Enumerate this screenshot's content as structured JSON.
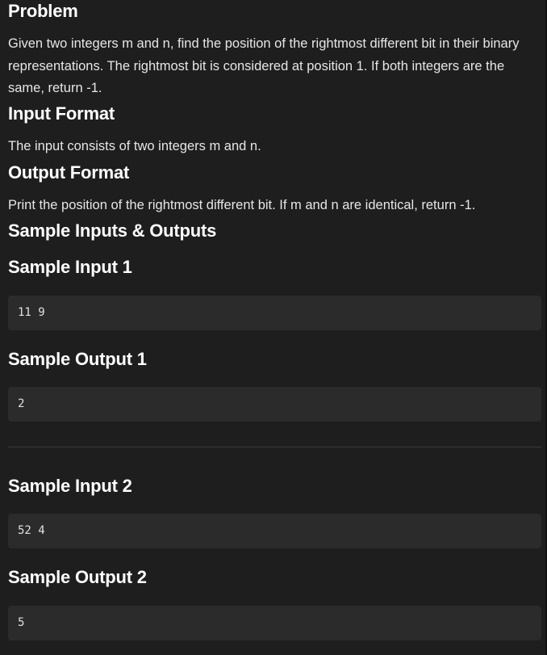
{
  "problem": {
    "heading": "Problem",
    "description": "Given two integers m and n, find the position of the rightmost different bit in their binary representations. The rightmost bit is considered at position 1. If both integers are the same, return -1."
  },
  "input_format": {
    "heading": "Input Format",
    "text": "The input consists of two integers m and n."
  },
  "output_format": {
    "heading": "Output Format",
    "text": "Print the position of the rightmost different bit. If m and n are identical, return -1."
  },
  "samples": {
    "heading": "Sample Inputs & Outputs",
    "items": [
      {
        "input_label": "Sample Input 1",
        "input": "11 9",
        "output_label": "Sample Output 1",
        "output": "2"
      },
      {
        "input_label": "Sample Input 2",
        "input": "52 4",
        "output_label": "Sample Output 2",
        "output": "5"
      }
    ]
  },
  "colors": {
    "background": "#1e1e1e",
    "code_block": "#2b2b2b",
    "heading_text": "#ffffff",
    "body_text": "#e6e6e6",
    "divider": "#3a3a3a"
  }
}
